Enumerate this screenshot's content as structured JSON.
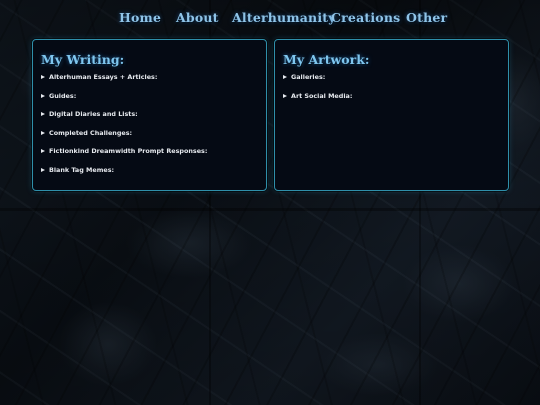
{
  "nav": {
    "items": [
      {
        "label": "Home"
      },
      {
        "label": "About"
      },
      {
        "label": "Alterhumanity"
      },
      {
        "label": "Creations"
      },
      {
        "label": "Other"
      }
    ]
  },
  "writing": {
    "title": "My Writing:",
    "items": [
      {
        "label": "Alterhuman Essays + Articles:"
      },
      {
        "label": "Guides:"
      },
      {
        "label": "Digital Diaries and Lists:"
      },
      {
        "label": "Completed Challenges:"
      },
      {
        "label": "Fictionkind Dreamwidth Prompt Responses:"
      },
      {
        "label": "Blank Tag Memes:"
      }
    ]
  },
  "artwork": {
    "title": "My Artwork:",
    "items": [
      {
        "label": "Galleries:"
      },
      {
        "label": "Art Social Media:"
      }
    ]
  },
  "colors": {
    "accent": "#8fc4e8",
    "panel_border": "#2f8faa",
    "panel_bg": "#050a14",
    "text": "#e6e9ee"
  }
}
